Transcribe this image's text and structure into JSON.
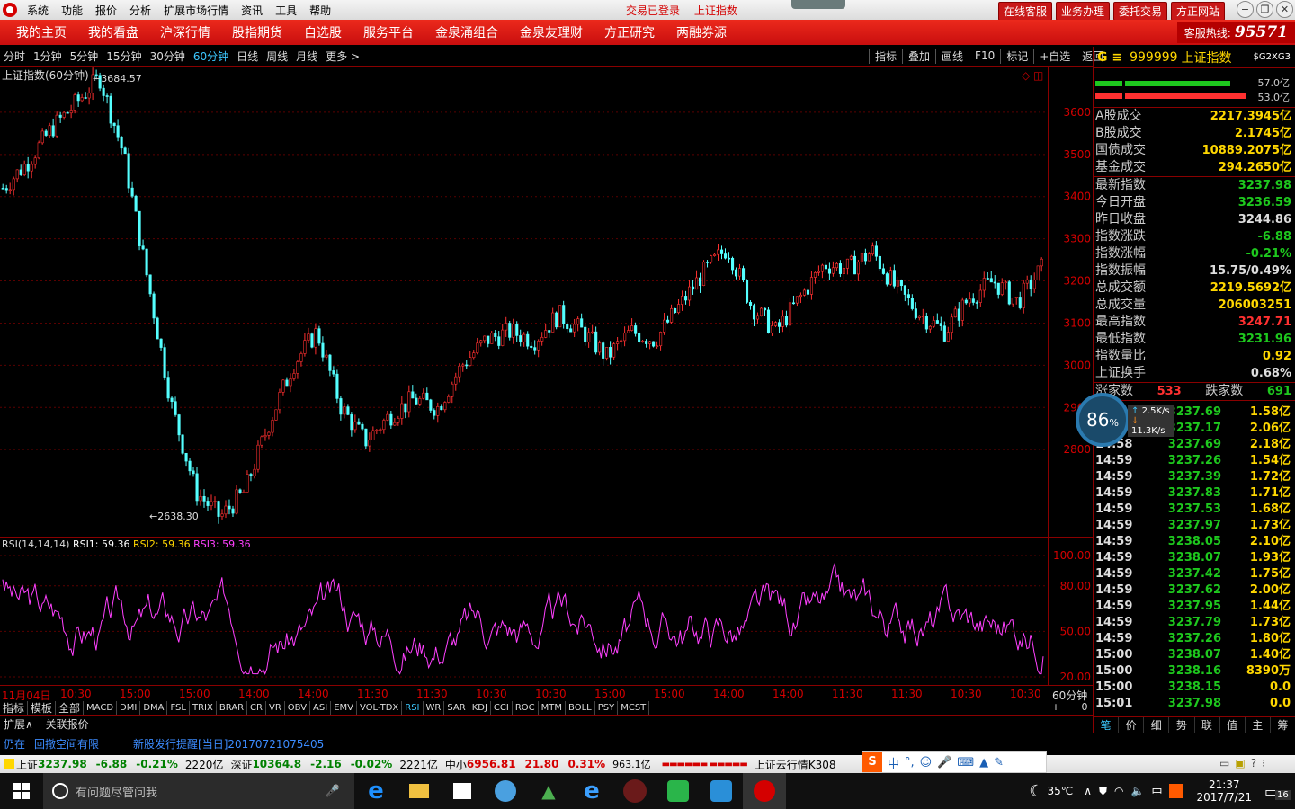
{
  "menubar": {
    "items": [
      "系统",
      "功能",
      "报价",
      "分析",
      "扩展市场行情",
      "资讯",
      "工具",
      "帮助"
    ],
    "status": [
      "交易已登录",
      "上证指数"
    ],
    "quick_buttons": [
      "在线客服",
      "业务办理",
      "委托交易",
      "方正网站"
    ]
  },
  "navbar": {
    "items": [
      "我的主页",
      "我的看盘",
      "沪深行情",
      "股指期货",
      "自选股",
      "服务平台",
      "金泉涌组合",
      "金泉友理财",
      "方正研究",
      "两融券源"
    ],
    "hotline_label": "客服热线:",
    "hotline_number": "95571"
  },
  "periods": [
    "分时",
    "1分钟",
    "5分钟",
    "15分钟",
    "30分钟",
    "60分钟",
    "日线",
    "周线",
    "月线",
    "更多 >"
  ],
  "active_period": "60分钟",
  "toolbar": [
    "指标",
    "叠加",
    "画线",
    "F10",
    "标记",
    "+自选",
    "返回"
  ],
  "chart": {
    "title": "上证指数(60分钟)",
    "high_label": "3684.57",
    "low_label": "2638.30"
  },
  "chart_data": {
    "type": "candlestick",
    "title": "上证指数(60分钟)",
    "y_ticks": [
      3600,
      3500,
      3400,
      3300,
      3200,
      3100,
      3000,
      2900,
      2800
    ],
    "ylim": [
      2600,
      3700
    ],
    "high": 3684.57,
    "low": 2638.3,
    "x_labels": [
      "11月04日",
      "10:30",
      "15:00",
      "15:00",
      "14:00",
      "14:00",
      "11:30",
      "11:30",
      "10:30",
      "10:30",
      "15:00",
      "15:00",
      "14:00",
      "14:00",
      "11:30",
      "11:30",
      "10:30",
      "10:30"
    ],
    "x_unit": "60分钟",
    "trend": [
      3420,
      3480,
      3560,
      3620,
      3684,
      3500,
      3200,
      2900,
      2700,
      2640,
      2700,
      2860,
      3000,
      3080,
      2900,
      2820,
      2880,
      2920,
      2900,
      3000,
      3060,
      3080,
      3060,
      3120,
      3080,
      3020,
      3080,
      3060,
      3140,
      3220,
      3280,
      3140,
      3080,
      3160,
      3240,
      3230,
      3270,
      3180,
      3120,
      3080,
      3160,
      3200,
      3150,
      3230
    ]
  },
  "rsi": {
    "legend": "RSI(14,14,14)",
    "rsi1": "RSI1: 59.36",
    "rsi2": "RSI2: 59.36",
    "rsi3": "RSI3: 59.36",
    "ticks": [
      "100.00",
      "80.00",
      "50.00",
      "20.00"
    ]
  },
  "indicator_tabs": [
    "指标",
    "模板",
    "全部",
    "MACD",
    "DMI",
    "DMA",
    "FSL",
    "TRIX",
    "BRAR",
    "CR",
    "VR",
    "OBV",
    "ASI",
    "EMV",
    "VOL-TDX",
    "RSI",
    "WR",
    "SAR",
    "KDJ",
    "CCI",
    "ROC",
    "MTM",
    "BOLL",
    "PSY",
    "MCST"
  ],
  "active_indicator": "RSI",
  "extbar": [
    "扩展∧",
    "关联报价"
  ],
  "zoom_controls": [
    "+",
    "−",
    "0"
  ],
  "rpanel": {
    "code": "999999",
    "name": "上证指数",
    "tag": "$G2XG3",
    "bar1_label": "57.0亿",
    "bar2_label": "53.0亿",
    "turnover": [
      {
        "k": "A股成交",
        "v": "2217.3945亿"
      },
      {
        "k": "B股成交",
        "v": "2.1745亿"
      },
      {
        "k": "国债成交",
        "v": "10889.2075亿"
      },
      {
        "k": "基金成交",
        "v": "294.2650亿"
      }
    ],
    "stats": [
      {
        "k": "最新指数",
        "v": "3237.98",
        "c": "#1ec81e"
      },
      {
        "k": "今日开盘",
        "v": "3236.59",
        "c": "#1ec81e"
      },
      {
        "k": "昨日收盘",
        "v": "3244.86",
        "c": "#ddd"
      },
      {
        "k": "指数涨跌",
        "v": "-6.88",
        "c": "#1ec81e"
      },
      {
        "k": "指数涨幅",
        "v": "-0.21%",
        "c": "#1ec81e"
      },
      {
        "k": "指数振幅",
        "v": "15.75/0.49%",
        "c": "#ddd"
      },
      {
        "k": "总成交额",
        "v": "2219.5692亿",
        "c": "#ffd700"
      },
      {
        "k": "总成交量",
        "v": "206003251",
        "c": "#ffd700"
      },
      {
        "k": "最高指数",
        "v": "3247.71",
        "c": "#ff3030"
      },
      {
        "k": "最低指数",
        "v": "3231.96",
        "c": "#1ec81e"
      },
      {
        "k": "指数量比",
        "v": "0.92",
        "c": "#ffd700"
      },
      {
        "k": "上证换手",
        "v": "0.68%",
        "c": "#ddd"
      }
    ],
    "up_label": "涨家数",
    "up_count": "533",
    "down_label": "跌家数",
    "down_count": "691",
    "trades": [
      {
        "t": "",
        "p": "3237.69",
        "v": "1.58亿"
      },
      {
        "t": "",
        "p": "3237.17",
        "v": "2.06亿"
      },
      {
        "t": "14:58",
        "p": "3237.69",
        "v": "2.18亿"
      },
      {
        "t": "14:59",
        "p": "3237.26",
        "v": "1.54亿"
      },
      {
        "t": "14:59",
        "p": "3237.39",
        "v": "1.72亿"
      },
      {
        "t": "14:59",
        "p": "3237.83",
        "v": "1.71亿"
      },
      {
        "t": "14:59",
        "p": "3237.53",
        "v": "1.68亿"
      },
      {
        "t": "14:59",
        "p": "3237.97",
        "v": "1.73亿"
      },
      {
        "t": "14:59",
        "p": "3238.05",
        "v": "2.10亿"
      },
      {
        "t": "14:59",
        "p": "3238.07",
        "v": "1.93亿"
      },
      {
        "t": "14:59",
        "p": "3237.42",
        "v": "1.75亿"
      },
      {
        "t": "14:59",
        "p": "3237.62",
        "v": "2.00亿"
      },
      {
        "t": "14:59",
        "p": "3237.95",
        "v": "1.44亿"
      },
      {
        "t": "14:59",
        "p": "3237.79",
        "v": "1.73亿"
      },
      {
        "t": "14:59",
        "p": "3237.26",
        "v": "1.80亿"
      },
      {
        "t": "15:00",
        "p": "3238.07",
        "v": "1.40亿"
      },
      {
        "t": "15:00",
        "p": "3238.16",
        "v": "8390万"
      },
      {
        "t": "15:00",
        "p": "3238.15",
        "v": "0.0"
      },
      {
        "t": "15:01",
        "p": "3237.98",
        "v": "0.0"
      }
    ],
    "tabs": [
      "笔",
      "价",
      "细",
      "势",
      "联",
      "值",
      "主",
      "筹"
    ]
  },
  "netw": {
    "percent": "86",
    "pct_sign": "%",
    "up": "2.5K/s",
    "down": "11.3K/s"
  },
  "news": [
    "仍在",
    "回撤空间有限",
    "新股发行提醒[当日]20170721075405"
  ],
  "statusbar": {
    "sh_label": "上证",
    "sh_val": "3237.98",
    "sh_chg": "-6.88",
    "sh_pct": "-0.21%",
    "sh_amt": "2220亿",
    "sz_label": "深证",
    "sz_val": "10364.8",
    "sz_chg": "-2.16",
    "sz_pct": "-0.02%",
    "sz_amt": "2221亿",
    "zx_label": "中小",
    "zx_val": "6956.81",
    "zx_chg": "21.80",
    "zx_pct": "0.31%",
    "zx_amt": "963.1亿",
    "cloud": "上证云行情K308"
  },
  "ime": [
    "中",
    "°,",
    "☺",
    "🎤",
    "⌨"
  ],
  "taskbar": {
    "search_placeholder": "有问题尽管问我",
    "weather": "35℃",
    "ime_lang": "中",
    "time": "21:37",
    "date": "2017/7/21",
    "notif": "16"
  }
}
